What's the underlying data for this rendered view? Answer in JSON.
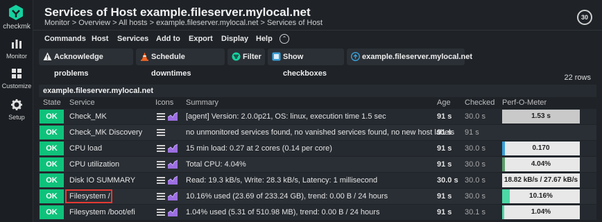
{
  "sidebar": {
    "logo_text": "checkmk",
    "items": [
      {
        "label": "Monitor",
        "icon": "bar-chart-icon"
      },
      {
        "label": "Customize",
        "icon": "grid-icon"
      },
      {
        "label": "Setup",
        "icon": "gear-icon"
      }
    ]
  },
  "header": {
    "title": "Services of Host example.fileserver.mylocal.net",
    "breadcrumb": "Monitor > Overview > All hosts > example.fileserver.mylocal.net > Services of Host",
    "refresh": "30"
  },
  "menu": [
    "Commands",
    "Host",
    "Services",
    "Add to",
    "Export",
    "Display",
    "Help"
  ],
  "toolbar": {
    "acknowledge": "Acknowledge problems",
    "downtimes": "Schedule downtimes",
    "filter": "Filter",
    "checkboxes": "Show checkboxes",
    "host": "example.fileserver.mylocal.net"
  },
  "rows_count": "22 rows",
  "host_group": "example.fileserver.mylocal.net",
  "columns": [
    "State",
    "Service",
    "Icons",
    "Summary",
    "Age",
    "Checked",
    "Perf-O-Meter"
  ],
  "rows": [
    {
      "state": "OK",
      "service": "Check_MK",
      "summary": "[agent] Version: 2.0.0p21, OS: linux, execution time 1.5 sec",
      "age": "91 s",
      "checked": "30.0 s",
      "perf": "1.53 s",
      "fill": 1.0,
      "fill_color": "#c9c9c9",
      "graph": true
    },
    {
      "state": "OK",
      "service": "Check_MK Discovery",
      "summary": "no unmonitored services found, no vanished services found, no new host labels",
      "age": "91 s",
      "checked": "91 s",
      "perf": "",
      "fill": 0,
      "fill_color": "",
      "graph": false
    },
    {
      "state": "OK",
      "service": "CPU load",
      "summary": "15 min load: 0.27 at 2 cores (0.14 per core)",
      "age": "91 s",
      "checked": "30.0 s",
      "perf": "0.170",
      "fill": 0.04,
      "fill_color": "#3a9fd6",
      "graph": true
    },
    {
      "state": "OK",
      "service": "CPU utilization",
      "summary": "Total CPU: 4.04%",
      "age": "91 s",
      "checked": "30.0 s",
      "perf": "4.04%",
      "fill": 0.04,
      "fill_color": "#5a9e6a",
      "graph": true
    },
    {
      "state": "OK",
      "service": "Disk IO SUMMARY",
      "summary": "Read: 19.3 kB/s, Write: 28.3 kB/s, Latency: 1 millisecond",
      "age": "30.0 s",
      "checked": "30.0 s",
      "perf": "18.82 kB/s / 27.67 kB/s",
      "fill": 0,
      "fill_color": "",
      "graph": true
    },
    {
      "state": "OK",
      "service": "Filesystem /",
      "summary": "10.16% used (23.69 of 233.24 GB), trend: 0.00 B / 24 hours",
      "age": "91 s",
      "checked": "30.0 s",
      "perf": "10.16%",
      "fill": 0.1016,
      "fill_color": "#4cd9a6",
      "graph": true
    },
    {
      "state": "OK",
      "service": "Filesystem /boot/efi",
      "summary": "1.04% used (5.31 of 510.98 MB), trend: 0.00 B / 24 hours",
      "age": "91 s",
      "checked": "30.1 s",
      "perf": "1.04%",
      "fill": 0.0104,
      "fill_color": "#4cd9a6",
      "graph": true
    }
  ],
  "colors": {
    "ok": "#0fc27b",
    "accent": "#15d1a0",
    "background": "#1f2328"
  }
}
